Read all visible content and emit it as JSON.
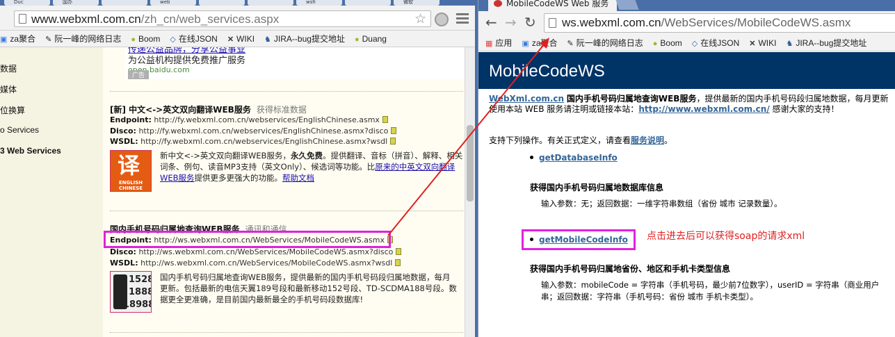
{
  "left_window": {
    "tabs": [
      "Duc",
      "国办",
      "",
      "web",
      "",
      "",
      "wsfi",
      "",
      "微软"
    ],
    "url_domain": "www.webxml.com.cn",
    "url_path": "/zh_cn/web_services.aspx",
    "bookmarks": [
      {
        "label": "za聚合",
        "icon": "za-icon"
      },
      {
        "label": "阮一峰的网络日志",
        "icon": "blog-icon"
      },
      {
        "label": "Boom",
        "icon": "leaf-icon"
      },
      {
        "label": "在线JSON",
        "icon": "code-icon"
      },
      {
        "label": "WIKI",
        "icon": "x-icon"
      },
      {
        "label": "JIRA--bug提交地址",
        "icon": "jira-icon"
      },
      {
        "label": "Duang",
        "icon": "leaf-icon"
      }
    ],
    "nav_items": [
      "数据",
      "媒体",
      "位换算",
      "o Services",
      "3 Web Services"
    ],
    "ad": {
      "line1": "传递公益品牌，分享公益事业",
      "line2": "为公益机构提供免费推广服务",
      "line3": "open.baidu.com",
      "badge": "广告"
    },
    "service1": {
      "title": "[新] 中文<->英文双向翻译WEB服务",
      "category": "获得标准数据",
      "endpoint_label": "Endpoint:",
      "endpoint": "http://fy.webxml.com.cn/webservices/EnglishChinese.asmx",
      "disco_label": "Disco:",
      "disco": "http://fy.webxml.com.cn/webservices/EnglishChinese.asmx?disco",
      "wsdl_label": "WSDL:",
      "wsdl": "http://fy.webxml.com.cn/webservices/EnglishChinese.asmx?wsdl",
      "desc_a": "新中文<->英文双向翻译WEB服务，",
      "desc_b": "永久免费",
      "desc_c": "。提供翻译、音标（拼音）、解释、",
      "desc_d": "相关词条、例句、读音MP3支持（英文Only）、候选词等功能。比",
      "desc_link1": "原来的中英文双向翻译WEB服务",
      "desc_e": "提供更多更强大的功能。",
      "desc_link2": "帮助文档",
      "thumb_big": "译",
      "thumb_small1": "ENGLISH",
      "thumb_small2": "CHINESE"
    },
    "service2": {
      "title": "国内手机号码归属地查询WEB服务",
      "category": "通讯和通信",
      "endpoint_label": "Endpoint:",
      "endpoint": "http://ws.webxml.com.cn/WebServices/MobileCodeWS.asmx",
      "disco_label": "Disco:",
      "disco": "http://ws.webxml.com.cn/WebServices/MobileCodeWS.asmx?disco",
      "wsdl_label": "WSDL:",
      "wsdl": "http://ws.webxml.com.cn/WebServices/MobileCodeWS.asmx?wsdl",
      "desc1": "国内手机号码归属地查询WEB服务，提供最新的国内手机号码段归属地数据，每月",
      "desc2": "更新。包括最新的电信天翼189号段和最新移动152号段、TD-SCDMA188号段。数",
      "desc3": "据更全更准确，是目前国内最新最全的手机号码段数据库!",
      "thumb_nums": [
        "1528",
        "1888",
        "18988"
      ]
    }
  },
  "right_window": {
    "tab_title": "MobileCodeWS Web 服务",
    "url_domain": "ws.webxml.com.cn",
    "url_path": "/WebServices/MobileCodeWS.asmx",
    "bookmarks": [
      {
        "label": "应用",
        "icon": "apps-icon"
      },
      {
        "label": "za聚合",
        "icon": "za-icon"
      },
      {
        "label": "阮一峰的网络日志",
        "icon": "blog-icon"
      },
      {
        "label": "Boom",
        "icon": "leaf-icon"
      },
      {
        "label": "在线JSON",
        "icon": "code-icon"
      },
      {
        "label": "WIKI",
        "icon": "x-icon"
      },
      {
        "label": "JIRA--bug提交地址",
        "icon": "jira-icon"
      }
    ],
    "header_title": "MobileCodeWS",
    "intro_link": "WebXml.com.cn",
    "intro_bold": "国内手机号码归属地查询WEB服务",
    "intro_text1": "，提供最新的国内手机号码段归属地数据，每月更新",
    "intro_text2": "使用本站 WEB 服务请注明或链接本站：",
    "intro_link2": "http://www.webxml.com.cn/",
    "intro_text3": " 感谢大家的支持！",
    "supports_text": "支持下列操作。有关正式定义，请查看",
    "supports_link": "服务说明",
    "supports_end": "。",
    "op1_name": "getDatabaseInfo",
    "op1_heading": "获得国内手机号码归属地数据库信息",
    "op1_desc": "输入参数：无；返回数据：一维字符串数组（省份 城市 记录数量）。",
    "op2_name": "getMobileCodeInfo",
    "op2_heading": "获得国内手机号码归属地省份、地区和手机卡类型信息",
    "op2_desc1": "输入参数：mobileCode = 字符串（手机号码，最少前7位数字），userID = 字符串（商业用户",
    "op2_desc2": "串；返回数据：字符串（手机号码：省份 城市 手机卡类型）。"
  },
  "annotation": {
    "note": "点击进去后可以获得soap的请求xml",
    "highlight_color": "#e020e0",
    "arrow_color": "#e02020"
  }
}
